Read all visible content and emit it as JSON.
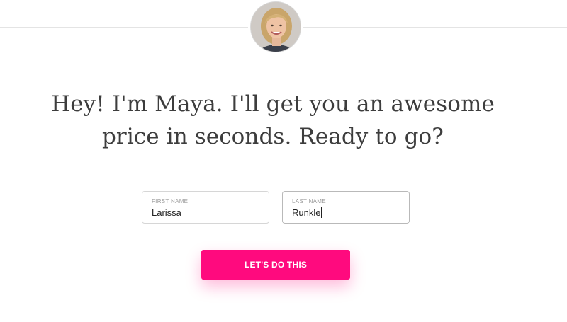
{
  "header": {
    "avatar_icon": "maya-avatar"
  },
  "intro": {
    "headline": "Hey! I'm Maya. I'll get you an awesome price in seconds. Ready to go?"
  },
  "form": {
    "first_name": {
      "label": "FIRST NAME",
      "value": "Larissa"
    },
    "last_name": {
      "label": "LAST NAME",
      "value": "Runkle"
    },
    "submit_label": "LET'S DO THIS"
  },
  "colors": {
    "accent": "#ff0a7e",
    "text": "#3d3d3d",
    "border": "#d6d6d6"
  }
}
